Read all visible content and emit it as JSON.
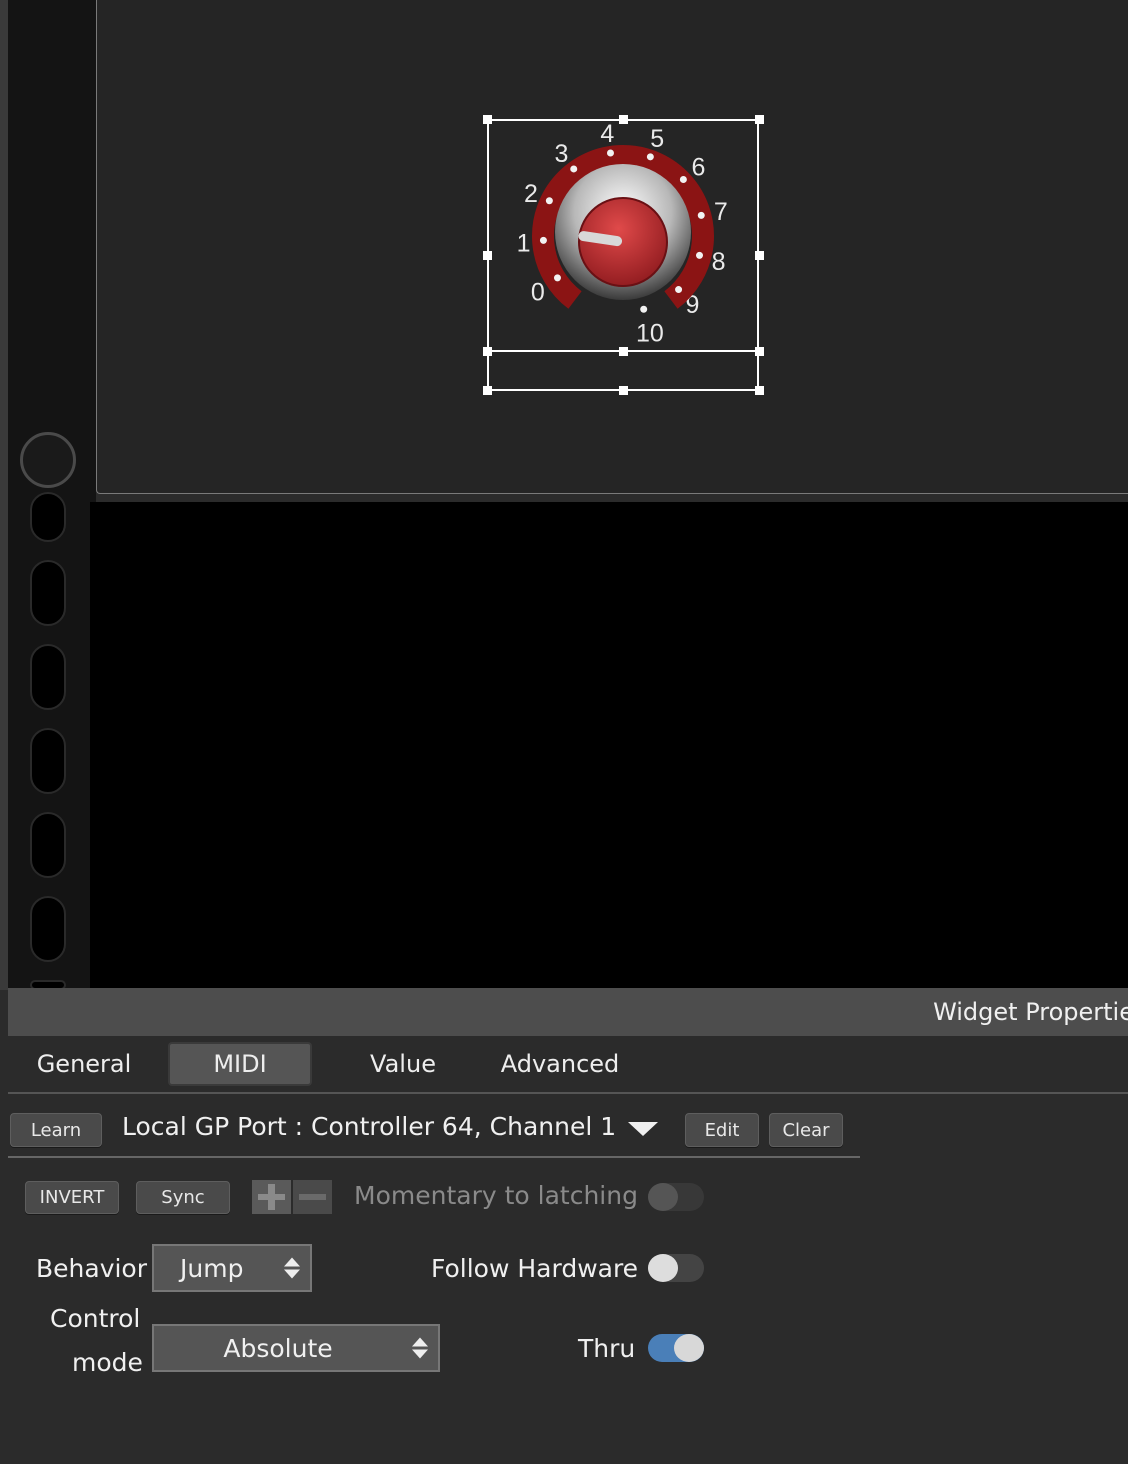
{
  "knob": {
    "scale_labels": [
      "0",
      "1",
      "2",
      "3",
      "4",
      "5",
      "6",
      "7",
      "8",
      "9",
      "10"
    ],
    "value": 1.5,
    "ring_color": "#8b1414",
    "cap_color": "#c0272d"
  },
  "properties": {
    "title": "Widget Propertie",
    "tabs": [
      {
        "label": "General",
        "active": false
      },
      {
        "label": "MIDI",
        "active": true
      },
      {
        "label": "Value",
        "active": false
      },
      {
        "label": "Advanced",
        "active": false
      }
    ],
    "learn_label": "Learn",
    "mapping": "Local GP Port : Controller 64, Channel 1",
    "edit_label": "Edit",
    "clear_label": "Clear",
    "invert_label": "INVERT",
    "sync_label": "Sync",
    "momentary_label": "Momentary to latching",
    "momentary_on": false,
    "behavior_label": "Behavior",
    "behavior_value": "Jump",
    "follow_hardware_label": "Follow Hardware",
    "follow_hardware_on": false,
    "control_mode_label_1": "Control",
    "control_mode_label_2": "mode",
    "control_mode_value": "Absolute",
    "thru_label": "Thru",
    "thru_on": true,
    "accent_color": "#4a7fb8"
  }
}
